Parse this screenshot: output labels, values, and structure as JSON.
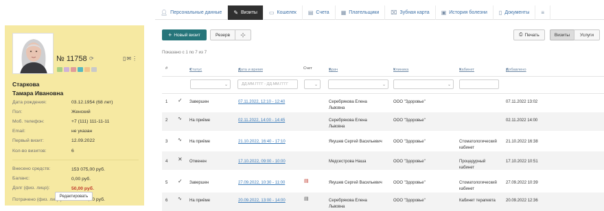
{
  "patient": {
    "card_number": "№ 11758",
    "refresh_icon": "refresh-icon",
    "swatch_colors": [
      "#a8cf84",
      "#cfb2d8",
      "#e09c9a",
      "#57b9bf",
      "#f2c389",
      "#c9c9c9"
    ],
    "surname": "Старкова",
    "given_names": "Тамара Ивановна",
    "fields": [
      {
        "label": "Дата рождения:",
        "value": "03.12.1954 (68 лет)"
      },
      {
        "label": "Пол:",
        "value": "Женский"
      },
      {
        "label": "Моб. телефон:",
        "value": "+7 (111) 111-11-11"
      },
      {
        "label": "Email:",
        "value": "не указан"
      },
      {
        "label": "Первый визит:",
        "value": "12.09.2022"
      },
      {
        "label": "Кол-во визитов:",
        "value": "6"
      }
    ],
    "finance": [
      {
        "label": "Внесено средств:",
        "value": "153 075,00 руб."
      },
      {
        "label": "Баланс:",
        "value": "0,00 руб."
      },
      {
        "label": "Долг (физ. лицо):",
        "value": "50,00 руб.",
        "highlight": true
      },
      {
        "label": "Потрачено (физ. лицо):",
        "value": "153 025,00 руб."
      }
    ],
    "edit_label": "Редактировать"
  },
  "tabs": [
    {
      "label": "Персональные данные",
      "icon": "person-icon"
    },
    {
      "label": "Визиты",
      "icon": "visits-icon",
      "active": true
    },
    {
      "label": "Кошелек",
      "icon": "wallet-icon"
    },
    {
      "label": "Счета",
      "icon": "invoice-icon"
    },
    {
      "label": "Плательщики",
      "icon": "payers-icon"
    },
    {
      "label": "Зубная карта",
      "icon": "tooth-icon"
    },
    {
      "label": "История болезни",
      "icon": "history-icon"
    },
    {
      "label": "Документы",
      "icon": "document-icon"
    },
    {
      "label": "",
      "icon": "menu-icon"
    }
  ],
  "toolbar": {
    "new_visit": "Новый визит",
    "reserve": "Резерв",
    "print": "Печать",
    "view_visits": "Визиты",
    "view_services": "Услуги"
  },
  "shown_text": "Показано с 1 по 7 из 7",
  "columns": {
    "num": "#",
    "status": "Статус",
    "datetime": "Дата и время",
    "bill": "Счет",
    "doctor": "Врач",
    "clinic": "Клиника",
    "office": "Кабинет",
    "added": "Добавлено"
  },
  "filters": {
    "date_placeholder": "ДД.ММ.ГГГГ - ДД.ММ.ГГГГ"
  },
  "rows": [
    {
      "num": "1",
      "status_icon": "check-icon",
      "status": "Завершен",
      "datetime": "07.11.2022, 12:10 - 12:40",
      "bill": "",
      "doctor_1": "Серебрякова Елена",
      "doctor_2": "Львовна",
      "clinic": "ООО \"Здоровье\"",
      "office_1": "",
      "office_2": "",
      "added": "07.11.2022 13:02"
    },
    {
      "num": "2",
      "status_icon": "pulse-icon",
      "status": "На приёме",
      "datetime": "02.11.2022, 14:00 - 14:45",
      "bill": "",
      "doctor_1": "Серебрякова Елена",
      "doctor_2": "Львовна",
      "clinic": "ООО \"Здоровье\"",
      "office_1": "",
      "office_2": "",
      "added": "02.11.2022 14:00"
    },
    {
      "num": "3",
      "status_icon": "pulse-icon",
      "status": "На приёме",
      "datetime": "21.10.2022, 16:40 - 17:10",
      "bill": "",
      "doctor_1": "Якушев Сергей Васильевич",
      "doctor_2": "",
      "clinic": "ООО \"Здоровье\"",
      "office_1": "Стоматологический",
      "office_2": "кабинет",
      "added": "21.10.2022 16:38"
    },
    {
      "num": "4",
      "status_icon": "cross-icon",
      "status": "Отменен",
      "datetime": "17.10.2022, 09:00 - 10:00",
      "bill": "",
      "doctor_1": "Медсестрова Наша",
      "doctor_2": "",
      "clinic": "ООО \"Здоровье\"",
      "office_1": "Процедурный",
      "office_2": "кабинет",
      "added": "17.10.2022 10:51"
    },
    {
      "num": "5",
      "status_icon": "check-icon",
      "status": "Завершен",
      "datetime": "27.09.2022, 10:30 - 11:00",
      "bill": "invoice-red-icon",
      "doctor_1": "Якушев Сергей Васильевич",
      "doctor_2": "",
      "clinic": "ООО \"Здоровье\"",
      "office_1": "Стоматологический",
      "office_2": "кабинет",
      "added": "27.09.2022 10:39"
    },
    {
      "num": "6",
      "status_icon": "pulse-icon",
      "status": "На приёме",
      "datetime": "20.09.2022, 13:00 - 14:00",
      "bill": "invoice-grey-icon",
      "doctor_1": "Серебрякова Елена",
      "doctor_2": "Львовна",
      "clinic": "ООО \"Здоровье\"",
      "office_1": "Кабинет терапевта",
      "office_2": "",
      "added": "20.09.2022 12:36"
    }
  ]
}
